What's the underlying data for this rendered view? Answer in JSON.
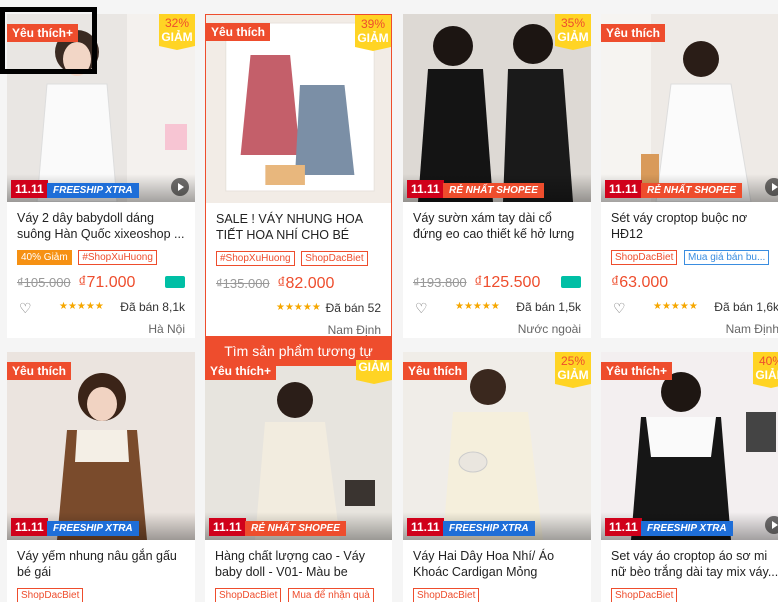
{
  "products": [
    {
      "fav": "Yêu thích+",
      "discount": "32%",
      "giam": "GIẢM",
      "promo_11": "11.11",
      "promo_label": "FREESHIP XTRA",
      "title": "Váy 2 dây babydoll dáng suông Hàn Quốc xixeoshop ...",
      "badge1": "40% Giảm",
      "badge2": "#ShopXuHuong",
      "old_price": "₫105.000",
      "price": "₫71.000",
      "sold": "Đã bán 8,1k",
      "location": "Hà Nội"
    },
    {
      "fav": "Yêu thích",
      "discount": "39%",
      "giam": "GIẢM",
      "title": "SALE ! VÁY NHUNG HOA TIẾT HOA NHÍ CHO BÉ GÁI...",
      "badge1": "#ShopXuHuong",
      "badge2": "ShopDacBiet",
      "old_price": "₫135.000",
      "price": "₫82.000",
      "sold": "Đã bán 52",
      "location": "Nam Định",
      "similar": "Tìm sản phẩm tương tự"
    },
    {
      "discount": "35%",
      "giam": "GIẢM",
      "promo_11": "11.11",
      "promo_label": "RẺ NHẤT SHOPEE",
      "title": "Váy sườn xám tay dài cổ đứng eo cao thiết kế hở lưng thời...",
      "old_price": "₫193.800",
      "price": "₫125.500",
      "sold": "Đã bán 1,5k",
      "location": "Nước ngoài"
    },
    {
      "fav": "Yêu thích",
      "promo_11": "11.11",
      "promo_label": "RẺ NHẤT SHOPEE",
      "title": "Sét váy croptop buộc nơ HĐ12",
      "badge1": "ShopDacBiet",
      "badge2": "Mua giá bán bu...",
      "price": "₫63.000",
      "sold": "Đã bán 1,6k",
      "location": "Nam Định"
    },
    {
      "fav": "Yêu thích",
      "promo_11": "11.11",
      "promo_label": "FREESHIP XTRA",
      "title": "Váy yếm nhung nâu gắn gấu bé gái",
      "badge1": "ShopDacBiet"
    },
    {
      "fav": "Yêu thích+",
      "giam": "GIẢM",
      "promo_11": "11.11",
      "promo_label": "RẺ NHẤT SHOPEE",
      "title": "Hàng chất lượng cao - Váy baby doll - V01- Màu be sữa...",
      "badge1": "ShopDacBiet",
      "badge2": "Mua để nhận quà"
    },
    {
      "fav": "Yêu thích",
      "discount": "25%",
      "giam": "GIẢM",
      "promo_11": "11.11",
      "promo_label": "FREESHIP XTRA",
      "title": "Váy Hai Dây Hoa Nhí/ Áo Khoác Cardigan Mỏng H004...",
      "badge1": "ShopDacBiet"
    },
    {
      "fav": "Yêu thích+",
      "discount": "40%",
      "giam": "GIẢM",
      "promo_11": "11.11",
      "promo_label": "FREESHIP XTRA",
      "title": "Set váy áo croptop áo sơ mi nữ bèo trắng dài tay mix váy...",
      "badge1": "ShopDacBiet"
    }
  ],
  "stars": "★★★★★",
  "colors": {
    "accent": "#ee4d2d",
    "discount_bg": "#ffd424"
  }
}
